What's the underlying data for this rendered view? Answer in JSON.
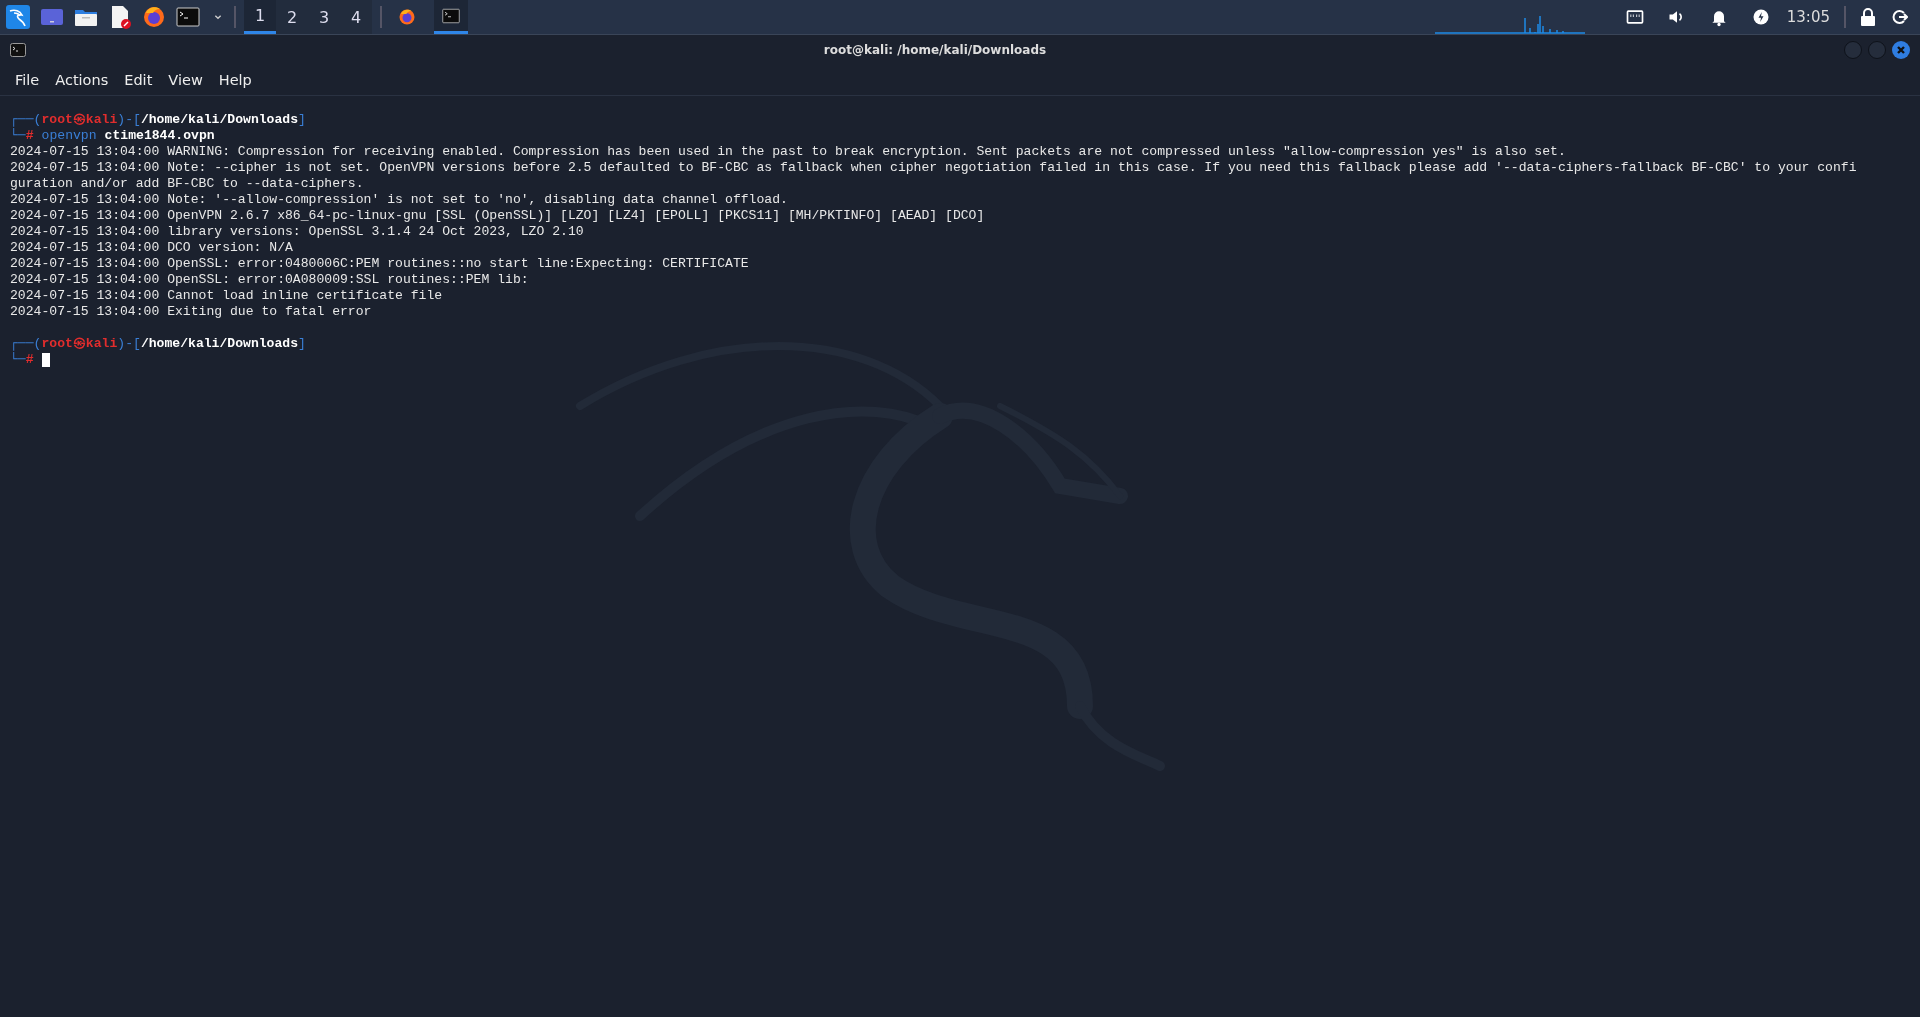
{
  "taskbar": {
    "launchers": [
      {
        "kind": "kali"
      },
      {
        "kind": "desktop"
      },
      {
        "kind": "folder"
      },
      {
        "kind": "editor"
      },
      {
        "kind": "firefox"
      },
      {
        "kind": "terminal"
      },
      {
        "kind": "caret"
      }
    ],
    "workspaces": [
      {
        "label": "1",
        "selected": true
      },
      {
        "label": "2",
        "selected": false
      },
      {
        "label": "3",
        "selected": false
      },
      {
        "label": "4",
        "selected": false
      }
    ],
    "tasks": [
      {
        "kind": "firefox",
        "selected": false
      },
      {
        "kind": "terminal",
        "selected": true
      }
    ],
    "tray": [
      {
        "kind": "network"
      },
      {
        "kind": "volume"
      },
      {
        "kind": "bell"
      },
      {
        "kind": "power"
      }
    ],
    "clock": "13:05"
  },
  "window": {
    "title": "root@kali: /home/kali/Downloads"
  },
  "menu": [
    "File",
    "Actions",
    "Edit",
    "View",
    "Help"
  ],
  "terminal": {
    "lines": [
      {
        "kind": "prompt",
        "parts": [
          {
            "kind": "frame",
            "text": "┌──("
          },
          {
            "kind": "user",
            "text": "root㉿kali"
          },
          {
            "kind": "frame",
            "text": ")-["
          },
          {
            "kind": "path",
            "text": "/home/kali/Downloads"
          },
          {
            "kind": "frame",
            "text": "]"
          }
        ]
      },
      {
        "kind": "command",
        "parts": [
          {
            "kind": "frame",
            "text": "└─"
          },
          {
            "kind": "hash",
            "text": "#"
          },
          {
            "kind": "command",
            "text": "openvpn"
          },
          {
            "kind": "args",
            "text": "ctime1844.ovpn"
          }
        ]
      },
      {
        "kind": "output",
        "text": "2024-07-15 13:04:00 WARNING: Compression for receiving enabled. Compression has been used in the past to break encryption. Sent packets are not compressed unless \"allow-compression yes\" is also set."
      },
      {
        "kind": "output",
        "text": "2024-07-15 13:04:00 Note: --cipher is not set. OpenVPN versions before 2.5 defaulted to BF-CBC as fallback when cipher negotiation failed in this case. If you need this fallback please add '--data-ciphers-fallback BF-CBC' to your confi"
      },
      {
        "kind": "output",
        "text": "guration and/or add BF-CBC to --data-ciphers."
      },
      {
        "kind": "output",
        "text": "2024-07-15 13:04:00 Note: '--allow-compression' is not set to 'no', disabling data channel offload."
      },
      {
        "kind": "output",
        "text": "2024-07-15 13:04:00 OpenVPN 2.6.7 x86_64-pc-linux-gnu [SSL (OpenSSL)] [LZO] [LZ4] [EPOLL] [PKCS11] [MH/PKTINFO] [AEAD] [DCO]"
      },
      {
        "kind": "output",
        "text": "2024-07-15 13:04:00 library versions: OpenSSL 3.1.4 24 Oct 2023, LZO 2.10"
      },
      {
        "kind": "output",
        "text": "2024-07-15 13:04:00 DCO version: N/A"
      },
      {
        "kind": "output",
        "text": "2024-07-15 13:04:00 OpenSSL: error:0480006C:PEM routines::no start line:Expecting: CERTIFICATE"
      },
      {
        "kind": "output",
        "text": "2024-07-15 13:04:00 OpenSSL: error:0A080009:SSL routines::PEM lib:"
      },
      {
        "kind": "output",
        "text": "2024-07-15 13:04:00 Cannot load inline certificate file"
      },
      {
        "kind": "output",
        "text": "2024-07-15 13:04:00 Exiting due to fatal error"
      },
      {
        "kind": "blank"
      },
      {
        "kind": "prompt",
        "parts": [
          {
            "kind": "frame",
            "text": "┌──("
          },
          {
            "kind": "user",
            "text": "root㉿kali"
          },
          {
            "kind": "frame",
            "text": ")-["
          },
          {
            "kind": "path",
            "text": "/home/kali/Downloads"
          },
          {
            "kind": "frame",
            "text": "]"
          }
        ]
      },
      {
        "kind": "command",
        "parts": [
          {
            "kind": "frame",
            "text": "└─"
          },
          {
            "kind": "hash",
            "text": "#"
          },
          {
            "kind": "cursor"
          }
        ]
      }
    ]
  }
}
